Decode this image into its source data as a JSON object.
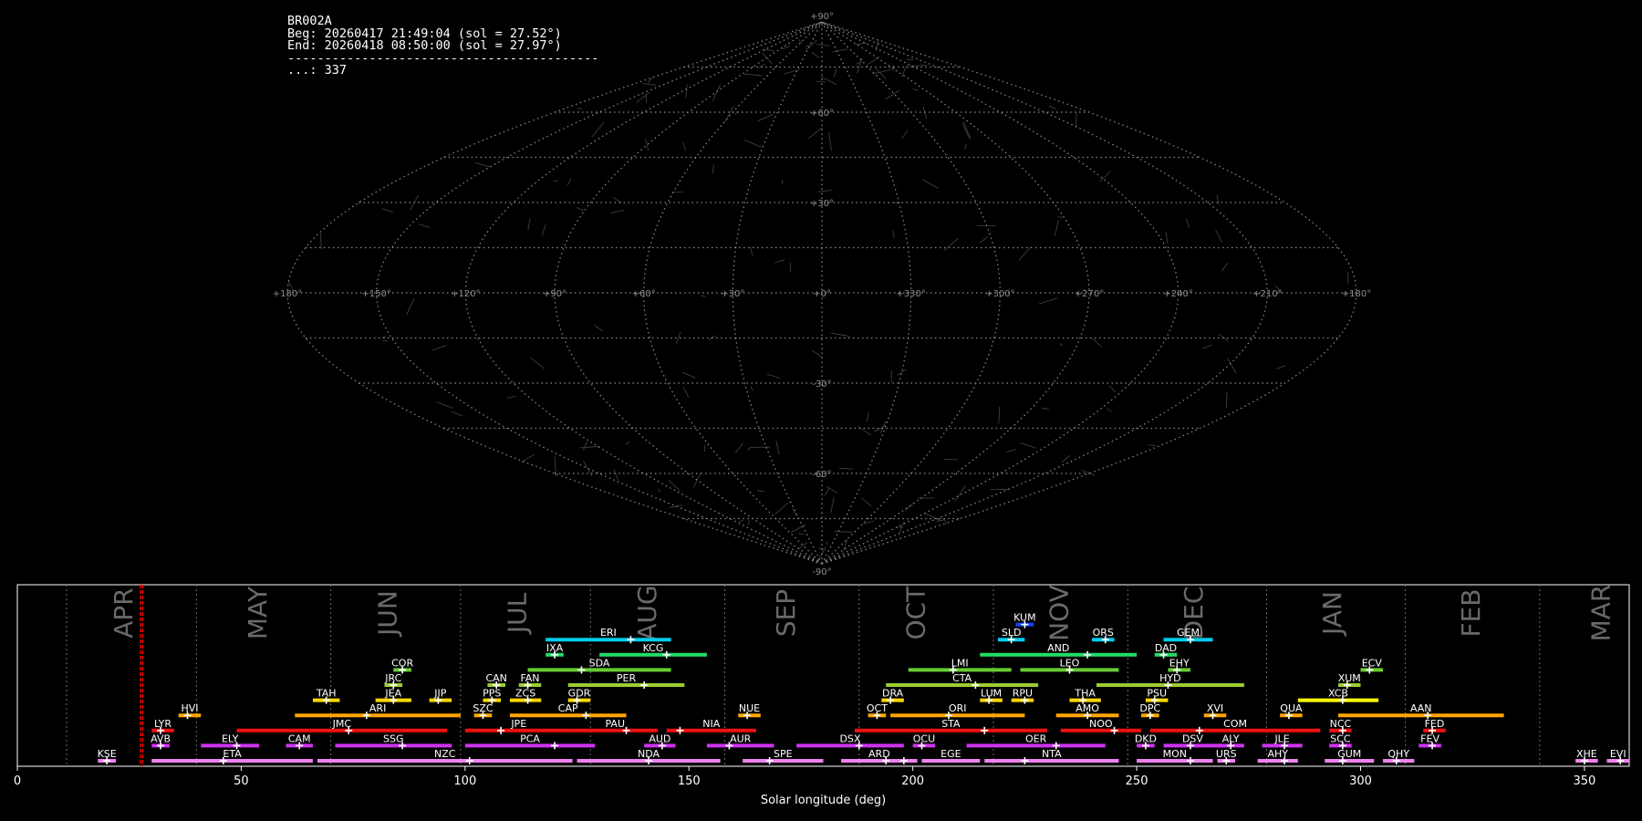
{
  "info": {
    "lines": [
      "BR002A",
      "Beg: 20260417 21:49:04 (sol = 27.52°)",
      "End: 20260418 08:50:00 (sol = 27.97°)",
      "------------------------------------------",
      "...: 337"
    ]
  },
  "sky_map": {
    "projection": "sinusoidal",
    "lon_labels": [
      "+180°",
      "+150°",
      "+120°",
      "+90°",
      "+60°",
      "+30°",
      "+0°",
      "+330°",
      "+300°",
      "+270°",
      "+240°",
      "+210°",
      "+180°"
    ],
    "lat_labels": [
      "+90°",
      "+60°",
      "+30°",
      "-30°",
      "-60°",
      "-90°"
    ],
    "grid_color": "#8c8c8c"
  },
  "chart_data": {
    "type": "timeline",
    "xlabel": "Solar longitude (deg)",
    "xlim": [
      0,
      360
    ],
    "xticks": [
      0,
      50,
      100,
      150,
      200,
      250,
      300,
      350
    ],
    "current_sol_range": [
      27.52,
      27.97
    ],
    "current_sol_color": "#ff0000",
    "months": [
      {
        "name": "APR",
        "sol": 24
      },
      {
        "name": "MAY",
        "sol": 54
      },
      {
        "name": "JUN",
        "sol": 83
      },
      {
        "name": "JUL",
        "sol": 112
      },
      {
        "name": "AUG",
        "sol": 141
      },
      {
        "name": "SEP",
        "sol": 172
      },
      {
        "name": "OCT",
        "sol": 201
      },
      {
        "name": "NOV",
        "sol": 233
      },
      {
        "name": "DEC",
        "sol": 263
      },
      {
        "name": "JAN",
        "sol": 294
      },
      {
        "name": "FEB",
        "sol": 325
      },
      {
        "name": "MAR",
        "sol": 354
      }
    ],
    "month_boundaries": [
      11,
      40,
      70,
      99,
      128,
      158,
      188,
      218,
      248,
      279,
      310,
      340
    ],
    "showers": [
      {
        "code": "KSE",
        "start": 18,
        "end": 22,
        "peak": 20,
        "row": 0,
        "color": "#ee82ee"
      },
      {
        "code": "ETA",
        "start": 30,
        "end": 66,
        "peak": 46,
        "row": 0,
        "color": "#ee82ee"
      },
      {
        "code": "NZC",
        "start": 67,
        "end": 124,
        "peak": 101,
        "row": 0,
        "color": "#ee82ee"
      },
      {
        "code": "NDA",
        "start": 125,
        "end": 157,
        "peak": 141,
        "row": 0,
        "color": "#ee82ee"
      },
      {
        "code": "SPE",
        "start": 162,
        "end": 180,
        "peak": 168,
        "row": 0,
        "color": "#ee82ee"
      },
      {
        "code": "ARD",
        "start": 184,
        "end": 201,
        "peak": 194,
        "row": 0,
        "color": "#ee82ee"
      },
      {
        "code": "EGE",
        "start": 202,
        "end": 215,
        "peak": 198,
        "row": 0,
        "color": "#ee82ee"
      },
      {
        "code": "NTA",
        "start": 216,
        "end": 246,
        "peak": 225,
        "row": 0,
        "color": "#ee82ee"
      },
      {
        "code": "MON",
        "start": 250,
        "end": 267,
        "peak": 262,
        "row": 0,
        "color": "#ee82ee"
      },
      {
        "code": "URS",
        "start": 268,
        "end": 272,
        "peak": 270,
        "row": 0,
        "color": "#ee82ee"
      },
      {
        "code": "AHY",
        "start": 277,
        "end": 286,
        "peak": 283,
        "row": 0,
        "color": "#ee82ee"
      },
      {
        "code": "GUM",
        "start": 292,
        "end": 303,
        "peak": 296,
        "row": 0,
        "color": "#ee82ee"
      },
      {
        "code": "QHY",
        "start": 305,
        "end": 312,
        "peak": 308,
        "row": 0,
        "color": "#ee82ee"
      },
      {
        "code": "XHE",
        "start": 348,
        "end": 353,
        "peak": 350,
        "row": 0,
        "color": "#ee82ee"
      },
      {
        "code": "EVI",
        "start": 355,
        "end": 360,
        "peak": 358,
        "row": 0,
        "color": "#ee82ee"
      },
      {
        "code": "AVB",
        "start": 30,
        "end": 34,
        "peak": 32,
        "row": 1,
        "color": "#cc33ee"
      },
      {
        "code": "ELY",
        "start": 41,
        "end": 54,
        "peak": 49,
        "row": 1,
        "color": "#cc33ee"
      },
      {
        "code": "CAM",
        "start": 60,
        "end": 66,
        "peak": 63,
        "row": 1,
        "color": "#cc33ee"
      },
      {
        "code": "SSG",
        "start": 71,
        "end": 97,
        "peak": 86,
        "row": 1,
        "color": "#cc33ee"
      },
      {
        "code": "PCA",
        "start": 100,
        "end": 129,
        "peak": 120,
        "row": 1,
        "color": "#cc33ee"
      },
      {
        "code": "AUD",
        "start": 140,
        "end": 147,
        "peak": 144,
        "row": 1,
        "color": "#cc33ee"
      },
      {
        "code": "AUR",
        "start": 154,
        "end": 169,
        "peak": 159,
        "row": 1,
        "color": "#cc33ee"
      },
      {
        "code": "DSX",
        "start": 174,
        "end": 198,
        "peak": 188,
        "row": 1,
        "color": "#cc33ee"
      },
      {
        "code": "OCU",
        "start": 200,
        "end": 205,
        "peak": 202,
        "row": 1,
        "color": "#cc33ee"
      },
      {
        "code": "OER",
        "start": 212,
        "end": 243,
        "peak": 232,
        "row": 1,
        "color": "#cc33ee"
      },
      {
        "code": "DKD",
        "start": 250,
        "end": 254,
        "peak": 252,
        "row": 1,
        "color": "#cc33ee"
      },
      {
        "code": "DSV",
        "start": 256,
        "end": 269,
        "peak": 262,
        "row": 1,
        "color": "#cc33ee"
      },
      {
        "code": "ALY",
        "start": 268,
        "end": 274,
        "peak": 271,
        "row": 1,
        "color": "#cc33ee"
      },
      {
        "code": "JLE",
        "start": 278,
        "end": 287,
        "peak": 283,
        "row": 1,
        "color": "#cc33ee"
      },
      {
        "code": "SCC",
        "start": 293,
        "end": 298,
        "peak": 296,
        "row": 1,
        "color": "#cc33ee"
      },
      {
        "code": "FEV",
        "start": 313,
        "end": 318,
        "peak": 316,
        "row": 1,
        "color": "#cc33ee"
      },
      {
        "code": "LYR",
        "start": 30,
        "end": 35,
        "peak": 32,
        "row": 2,
        "color": "#ee1111"
      },
      {
        "code": "JMC",
        "start": 49,
        "end": 96,
        "peak": 74,
        "row": 2,
        "color": "#ee1111"
      },
      {
        "code": "JPE",
        "start": 100,
        "end": 124,
        "peak": 108,
        "row": 2,
        "color": "#ee1111"
      },
      {
        "code": "PAU",
        "start": 124,
        "end": 143,
        "peak": 136,
        "row": 2,
        "color": "#ee1111"
      },
      {
        "code": "NIA",
        "start": 145,
        "end": 165,
        "peak": 148,
        "row": 2,
        "color": "#ee1111"
      },
      {
        "code": "STA",
        "start": 187,
        "end": 230,
        "peak": 216,
        "row": 2,
        "color": "#ee1111"
      },
      {
        "code": "NOO",
        "start": 233,
        "end": 251,
        "peak": 245,
        "row": 2,
        "color": "#ee1111"
      },
      {
        "code": "COM",
        "start": 253,
        "end": 291,
        "peak": 264,
        "row": 2,
        "color": "#ee1111"
      },
      {
        "code": "NCC",
        "start": 293,
        "end": 298,
        "peak": 296,
        "row": 2,
        "color": "#ee1111"
      },
      {
        "code": "FED",
        "start": 314,
        "end": 319,
        "peak": 316,
        "row": 2,
        "color": "#ee1111"
      },
      {
        "code": "HVI",
        "start": 36,
        "end": 41,
        "peak": 38,
        "row": 3,
        "color": "#ffa500"
      },
      {
        "code": "ARI",
        "start": 62,
        "end": 99,
        "peak": 78,
        "row": 3,
        "color": "#ffa500"
      },
      {
        "code": "SZC",
        "start": 102,
        "end": 106,
        "peak": 104,
        "row": 3,
        "color": "#ffa500"
      },
      {
        "code": "CAP",
        "start": 110,
        "end": 136,
        "peak": 127,
        "row": 3,
        "color": "#ffa500"
      },
      {
        "code": "NUE",
        "start": 161,
        "end": 166,
        "peak": 163,
        "row": 3,
        "color": "#ffa500"
      },
      {
        "code": "OCT",
        "start": 190,
        "end": 194,
        "peak": 192,
        "row": 3,
        "color": "#ffa500"
      },
      {
        "code": "ORI",
        "start": 195,
        "end": 225,
        "peak": 208,
        "row": 3,
        "color": "#ffa500"
      },
      {
        "code": "AMO",
        "start": 232,
        "end": 246,
        "peak": 239,
        "row": 3,
        "color": "#ffa500"
      },
      {
        "code": "DPC",
        "start": 251,
        "end": 255,
        "peak": 253,
        "row": 3,
        "color": "#ffa500"
      },
      {
        "code": "XVI",
        "start": 265,
        "end": 270,
        "peak": 267,
        "row": 3,
        "color": "#ffa500"
      },
      {
        "code": "QUA",
        "start": 282,
        "end": 287,
        "peak": 284,
        "row": 3,
        "color": "#ffa500"
      },
      {
        "code": "AAN",
        "start": 295,
        "end": 332,
        "peak": 315,
        "row": 3,
        "color": "#ffa500"
      },
      {
        "code": "TAH",
        "start": 66,
        "end": 72,
        "peak": 69,
        "row": 4,
        "color": "#ffd700"
      },
      {
        "code": "JEA",
        "start": 80,
        "end": 88,
        "peak": 84,
        "row": 4,
        "color": "#ffd700"
      },
      {
        "code": "JIP",
        "start": 92,
        "end": 97,
        "peak": 94,
        "row": 4,
        "color": "#ffd700"
      },
      {
        "code": "PPS",
        "start": 104,
        "end": 108,
        "peak": 106,
        "row": 4,
        "color": "#ffd700"
      },
      {
        "code": "ZCS",
        "start": 110,
        "end": 117,
        "peak": 114,
        "row": 4,
        "color": "#ffd700"
      },
      {
        "code": "GDR",
        "start": 123,
        "end": 128,
        "peak": 125,
        "row": 4,
        "color": "#ffd700"
      },
      {
        "code": "DRA",
        "start": 193,
        "end": 198,
        "peak": 195,
        "row": 4,
        "color": "#ffd700"
      },
      {
        "code": "LUM",
        "start": 215,
        "end": 220,
        "peak": 217,
        "row": 4,
        "color": "#ffd700"
      },
      {
        "code": "RPU",
        "start": 222,
        "end": 227,
        "peak": 225,
        "row": 4,
        "color": "#ffd700"
      },
      {
        "code": "THA",
        "start": 235,
        "end": 242,
        "peak": 238,
        "row": 4,
        "color": "#ffd700"
      },
      {
        "code": "PSU",
        "start": 252,
        "end": 257,
        "peak": 254,
        "row": 4,
        "color": "#ffd700"
      },
      {
        "code": "XCB",
        "start": 286,
        "end": 304,
        "peak": 296,
        "row": 4,
        "color": "#ffff00"
      },
      {
        "code": "JRC",
        "start": 82,
        "end": 86,
        "peak": 84,
        "row": 5,
        "color": "#9acd32"
      },
      {
        "code": "CAN",
        "start": 105,
        "end": 109,
        "peak": 107,
        "row": 5,
        "color": "#9acd32"
      },
      {
        "code": "FAN",
        "start": 112,
        "end": 117,
        "peak": 114,
        "row": 5,
        "color": "#9acd32"
      },
      {
        "code": "PER",
        "start": 123,
        "end": 149,
        "peak": 140,
        "row": 5,
        "color": "#9acd32"
      },
      {
        "code": "CTA",
        "start": 194,
        "end": 228,
        "peak": 214,
        "row": 5,
        "color": "#9acd32"
      },
      {
        "code": "HYD",
        "start": 241,
        "end": 274,
        "peak": 257,
        "row": 5,
        "color": "#9acd32"
      },
      {
        "code": "XUM",
        "start": 295,
        "end": 300,
        "peak": 297,
        "row": 5,
        "color": "#9acd32"
      },
      {
        "code": "COR",
        "start": 84,
        "end": 88,
        "peak": 86,
        "row": 6,
        "color": "#66cc33"
      },
      {
        "code": "SDA",
        "start": 114,
        "end": 146,
        "peak": 126,
        "row": 6,
        "color": "#66cc33"
      },
      {
        "code": "LMI",
        "start": 199,
        "end": 222,
        "peak": 209,
        "row": 6,
        "color": "#66cc33"
      },
      {
        "code": "LEO",
        "start": 224,
        "end": 246,
        "peak": 235,
        "row": 6,
        "color": "#66cc33"
      },
      {
        "code": "EHY",
        "start": 257,
        "end": 262,
        "peak": 259,
        "row": 6,
        "color": "#66cc33"
      },
      {
        "code": "ECV",
        "start": 300,
        "end": 305,
        "peak": 302,
        "row": 6,
        "color": "#66cc33"
      },
      {
        "code": "IXA",
        "start": 118,
        "end": 122,
        "peak": 120,
        "row": 7,
        "color": "#22dd66"
      },
      {
        "code": "KCG",
        "start": 130,
        "end": 154,
        "peak": 145,
        "row": 7,
        "color": "#22dd66"
      },
      {
        "code": "AND",
        "start": 215,
        "end": 250,
        "peak": 239,
        "row": 7,
        "color": "#22dd66"
      },
      {
        "code": "DAD",
        "start": 254,
        "end": 259,
        "peak": 256,
        "row": 7,
        "color": "#22dd66"
      },
      {
        "code": "ERI",
        "start": 118,
        "end": 146,
        "peak": 137,
        "row": 8,
        "color": "#00ccee"
      },
      {
        "code": "SLD",
        "start": 219,
        "end": 225,
        "peak": 222,
        "row": 8,
        "color": "#00ccee"
      },
      {
        "code": "ORS",
        "start": 240,
        "end": 245,
        "peak": 243,
        "row": 8,
        "color": "#00ccee"
      },
      {
        "code": "GEM",
        "start": 256,
        "end": 267,
        "peak": 262,
        "row": 8,
        "color": "#00ccee"
      },
      {
        "code": "KUM",
        "start": 223,
        "end": 227,
        "peak": 225,
        "row": 9,
        "color": "#1144ff"
      }
    ]
  }
}
